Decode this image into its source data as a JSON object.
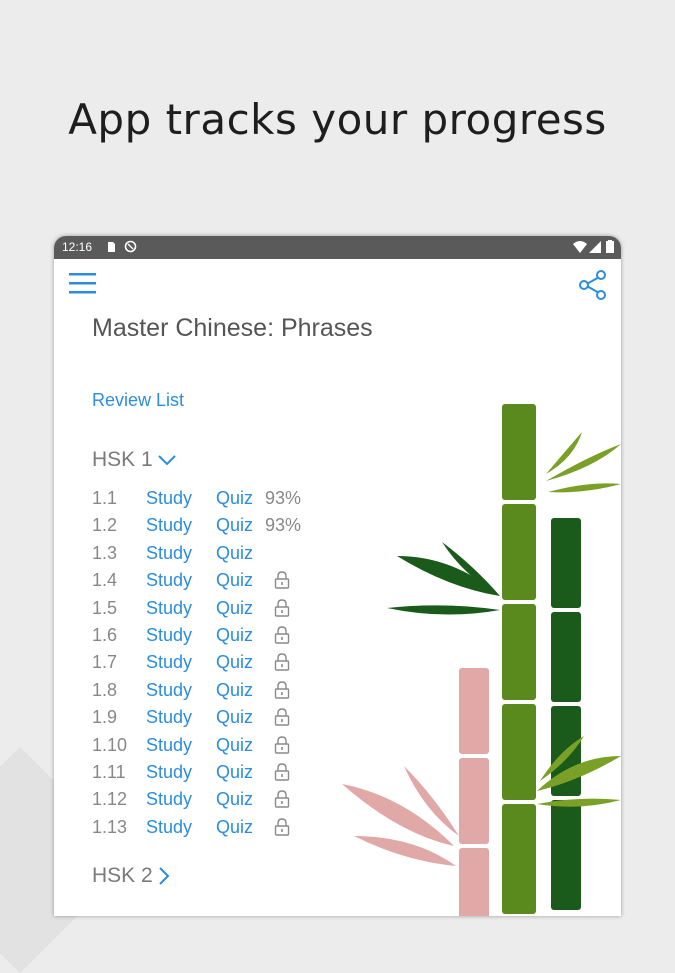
{
  "headline": "App tracks your progress",
  "status_bar": {
    "time": "12:16"
  },
  "app": {
    "title": "Master Chinese: Phrases",
    "review_list": "Review List",
    "sections": [
      {
        "label": "HSK 1",
        "expanded": true
      },
      {
        "label": "HSK 2",
        "expanded": false
      }
    ],
    "study_label": "Study",
    "quiz_label": "Quiz",
    "lessons": [
      {
        "num": "1.1",
        "score": "93%",
        "locked": false
      },
      {
        "num": "1.2",
        "score": "93%",
        "locked": false
      },
      {
        "num": "1.3",
        "score": "",
        "locked": false
      },
      {
        "num": "1.4",
        "score": "",
        "locked": true
      },
      {
        "num": "1.5",
        "score": "",
        "locked": true
      },
      {
        "num": "1.6",
        "score": "",
        "locked": true
      },
      {
        "num": "1.7",
        "score": "",
        "locked": true
      },
      {
        "num": "1.8",
        "score": "",
        "locked": true
      },
      {
        "num": "1.9",
        "score": "",
        "locked": true
      },
      {
        "num": "1.10",
        "score": "",
        "locked": true
      },
      {
        "num": "1.11",
        "score": "",
        "locked": true
      },
      {
        "num": "1.12",
        "score": "",
        "locked": true
      },
      {
        "num": "1.13",
        "score": "",
        "locked": true
      }
    ]
  },
  "colors": {
    "accent": "#2b8de0",
    "background": "#ececec",
    "status_bar": "#5a5a5a"
  }
}
